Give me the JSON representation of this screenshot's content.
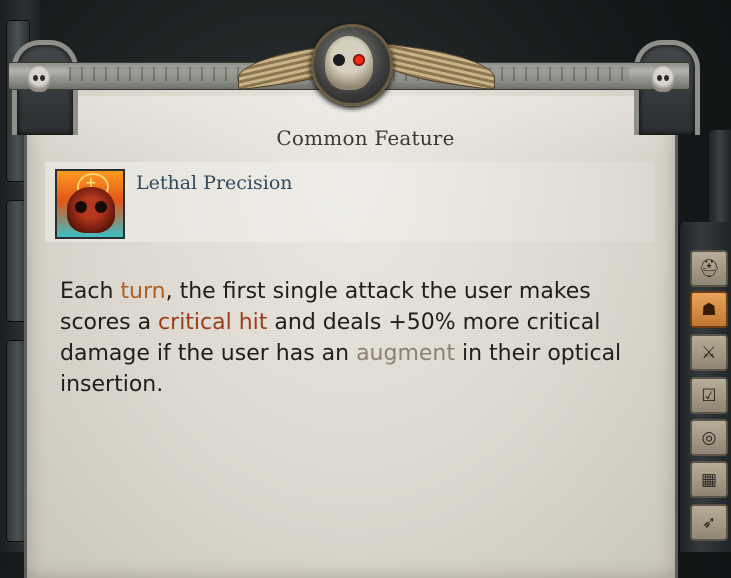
{
  "panel": {
    "title": "Common Feature"
  },
  "feature": {
    "name": "Lethal Precision",
    "icon": "skull-crosshair-icon"
  },
  "description": {
    "part1": "Each ",
    "kw_turn": "turn",
    "part2": ", the first single attack the user makes scores a ",
    "kw_crit": "critical hit",
    "part3": " and deals +50% more critical damage if the user has an ",
    "kw_augment": "augment",
    "part4": " in their optical insertion."
  },
  "tabs": [
    {
      "icon": "helmet-icon",
      "glyph": "⛑",
      "active": false
    },
    {
      "icon": "character-icon",
      "glyph": "☗",
      "active": true
    },
    {
      "icon": "weapon-icon",
      "glyph": "⚔",
      "active": false
    },
    {
      "icon": "checklist-icon",
      "glyph": "☑",
      "active": false
    },
    {
      "icon": "target-icon",
      "glyph": "◎",
      "active": false
    },
    {
      "icon": "building-icon",
      "glyph": "▦",
      "active": false
    },
    {
      "icon": "ship-icon",
      "glyph": "➶",
      "active": false
    }
  ],
  "colors": {
    "keyword_orange": "#b25e22",
    "keyword_red": "#9e3b1c",
    "keyword_grey": "#8d8175",
    "feature_name": "#2f4a5c",
    "active_tab": "#e8a45a"
  }
}
